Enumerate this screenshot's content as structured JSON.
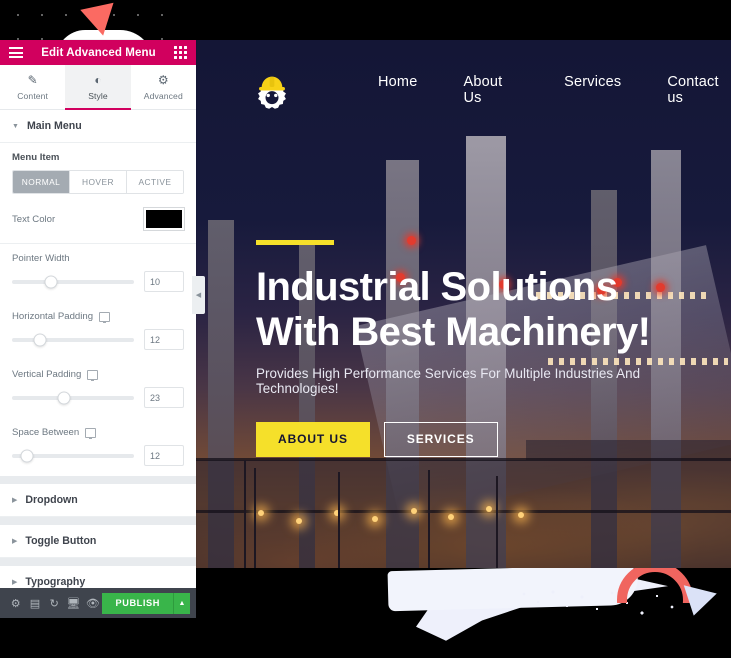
{
  "panel": {
    "header": {
      "title": "Edit Advanced Menu",
      "menu_icon": "hamburger-icon",
      "grid_icon": "grid-icon"
    },
    "tabs": [
      {
        "label": "Content",
        "icon": "pencil-icon",
        "active": false
      },
      {
        "label": "Style",
        "icon": "contrast-icon",
        "active": true
      },
      {
        "label": "Advanced",
        "icon": "gear-icon",
        "active": false
      }
    ],
    "sections": [
      {
        "label": "Main Menu",
        "expanded": true
      },
      {
        "label": "Dropdown",
        "expanded": false
      },
      {
        "label": "Toggle Button",
        "expanded": false
      },
      {
        "label": "Typography",
        "expanded": false
      }
    ],
    "controls": {
      "menu_item_label": "Menu Item",
      "states": [
        {
          "label": "NORMAL",
          "selected": true
        },
        {
          "label": "HOVER",
          "selected": false
        },
        {
          "label": "ACTIVE",
          "selected": false
        }
      ],
      "text_color": {
        "label": "Text Color",
        "value": "#000000"
      },
      "sliders": [
        {
          "label": "Pointer Width",
          "value": "10",
          "percent": 32,
          "responsive": false
        },
        {
          "label": "Horizontal Padding",
          "value": "12",
          "percent": 23,
          "responsive": true
        },
        {
          "label": "Vertical Padding",
          "value": "23",
          "percent": 43,
          "responsive": true
        },
        {
          "label": "Space Between",
          "value": "12",
          "percent": 12,
          "responsive": true
        }
      ]
    },
    "footer": {
      "icons": [
        "settings-gear-icon",
        "navigator-layers-icon",
        "history-revisions-icon",
        "responsive-mode-icon",
        "preview-eye-icon"
      ],
      "publish_label": "PUBLISH",
      "publish_arrow_icon": "chevron-up-icon",
      "publish_color": "#39b54a"
    },
    "collapse_handle_icon": "chevron-left-icon",
    "accent_color": "#d1005e"
  },
  "site": {
    "logo": {
      "name": "hard-hat-gear-logo",
      "hat_color": "#f7d117",
      "gear_color": "#ffffff"
    },
    "nav": [
      {
        "label": "Home"
      },
      {
        "label": "About Us"
      },
      {
        "label": "Services"
      },
      {
        "label": "Contact us"
      }
    ],
    "hero": {
      "heading_line1": "Industrial Solutions",
      "heading_line2": "With Best Machinery!",
      "subheading": "Provides High Performance Services For Multiple Industries And Technologies!",
      "rule_color": "#f5e02a",
      "buttons": [
        {
          "label": "ABOUT US",
          "style": "primary",
          "bg": "#f5e02a"
        },
        {
          "label": "SERVICES",
          "style": "outline",
          "bg": "transparent"
        }
      ]
    }
  },
  "decorations": {
    "dot_grid": "dot-grid-pattern",
    "triangle_top": {
      "name": "red-triangle",
      "color": "#fb6a62"
    },
    "brush_top": {
      "name": "white-brush-blob",
      "color": "#ffffff"
    },
    "brush_bottom": {
      "name": "white-brush-stroke",
      "color": "#eef0fb"
    },
    "arc_bottom": {
      "name": "red-arc",
      "color": "#f0655f"
    },
    "triangle_bottom": {
      "name": "blue-triangle",
      "color": "#dbe2f7"
    }
  }
}
